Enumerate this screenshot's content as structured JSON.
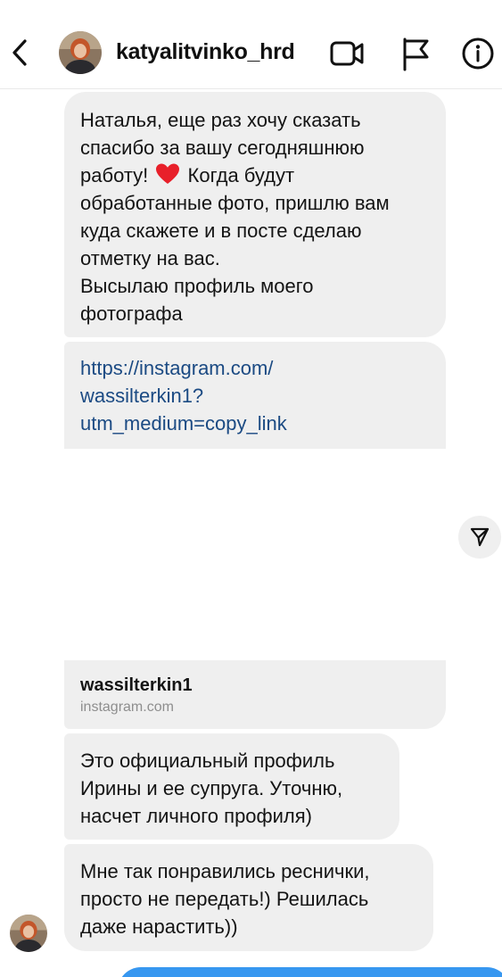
{
  "header": {
    "back_icon": "chevron-left-icon",
    "username": "katyalitvinko_hrd",
    "video_icon": "video-camera-icon",
    "flag_icon": "flag-icon",
    "info_icon": "info-icon"
  },
  "messages": [
    {
      "lines": [
        "Наталья, еще раз хочу сказать",
        "спасибо за вашу сегодняшнюю",
        "работу!",
        "Когда будут",
        "обработанные фото, пришлю вам",
        "куда скажете и в посте сделаю",
        "отметку на вас.",
        "Высылаю профиль моего",
        "фотографа"
      ],
      "emoji": "heart-emoji"
    },
    {
      "lines": [
        "https://instagram.com/",
        "wassilterkin1?",
        "utm_medium=copy_link"
      ]
    },
    {
      "link_title": "wassilterkin1",
      "link_domain": "instagram.com"
    },
    {
      "lines": [
        "Это официальный профиль",
        "Ирины и ее супруга. Уточню,",
        "насчет личного профиля)"
      ]
    },
    {
      "lines": [
        "Мне так понравились реснички,",
        "просто не передать!) Решилась",
        "даже нарастить))"
      ]
    }
  ],
  "share_icon": "send-arrow-icon",
  "colors": {
    "incoming_bubble": "#efefef",
    "link_text": "#1b4a83",
    "outgoing_bubble": "#3797f0",
    "heart": "#e8202a"
  }
}
